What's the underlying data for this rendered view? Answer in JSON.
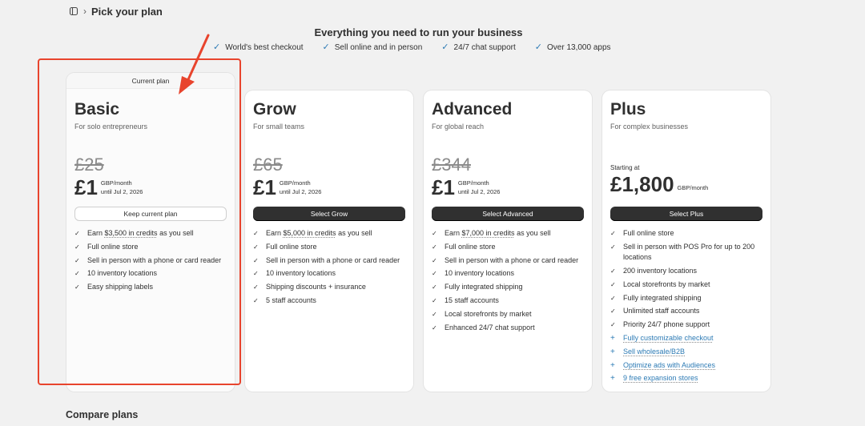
{
  "breadcrumb": {
    "title": "Pick your plan",
    "separator": "›"
  },
  "hero": {
    "title": "Everything you need to run your business",
    "features": [
      "World's best checkout",
      "Sell online and in person",
      "24/7 chat support",
      "Over 13,000 apps"
    ]
  },
  "plans": {
    "basic": {
      "tag": "Current plan",
      "name": "Basic",
      "subtitle": "For solo entrepreneurs",
      "old_price": "£25",
      "price": "£1",
      "period": "GBP/month",
      "until": "until Jul 2, 2026",
      "button": "Keep current plan",
      "features": [
        {
          "pre": "Earn ",
          "link": "$3,500 in credits",
          "post": " as you sell"
        },
        "Full online store",
        "Sell in person with a phone or card reader",
        "10 inventory locations",
        "Easy shipping labels"
      ]
    },
    "grow": {
      "name": "Grow",
      "subtitle": "For small teams",
      "old_price": "£65",
      "price": "£1",
      "period": "GBP/month",
      "until": "until Jul 2, 2026",
      "button": "Select Grow",
      "features": [
        {
          "pre": "Earn ",
          "link": "$5,000 in credits",
          "post": " as you sell"
        },
        "Full online store",
        "Sell in person with a phone or card reader",
        "10 inventory locations",
        "Shipping discounts + insurance",
        "5 staff accounts"
      ]
    },
    "advanced": {
      "name": "Advanced",
      "subtitle": "For global reach",
      "old_price": "£344",
      "price": "£1",
      "period": "GBP/month",
      "until": "until Jul 2, 2026",
      "button": "Select Advanced",
      "features": [
        {
          "pre": "Earn ",
          "link": "$7,000 in credits",
          "post": " as you sell"
        },
        "Full online store",
        "Sell in person with a phone or card reader",
        "10 inventory locations",
        "Fully integrated shipping",
        "15 staff accounts",
        "Local storefronts by market",
        "Enhanced 24/7 chat support"
      ]
    },
    "plus": {
      "name": "Plus",
      "subtitle": "For complex businesses",
      "starting": "Starting at",
      "price": "£1,800",
      "period": "GBP/month",
      "button": "Select Plus",
      "features": [
        "Full online store",
        "Sell in person with POS Pro for up to 200 locations",
        "200 inventory locations",
        "Local storefronts by market",
        "Fully integrated shipping",
        "Unlimited staff accounts",
        "Priority 24/7 phone support"
      ],
      "plus_features": [
        "Fully customizable checkout",
        "Sell wholesale/B2B",
        "Optimize ads with Audiences",
        "9 free expansion stores"
      ]
    }
  },
  "compare": {
    "title": "Compare plans"
  },
  "colors": {
    "accent_blue": "#2d7bb5",
    "annotation_red": "#e8442d",
    "dark_button": "#303030"
  }
}
